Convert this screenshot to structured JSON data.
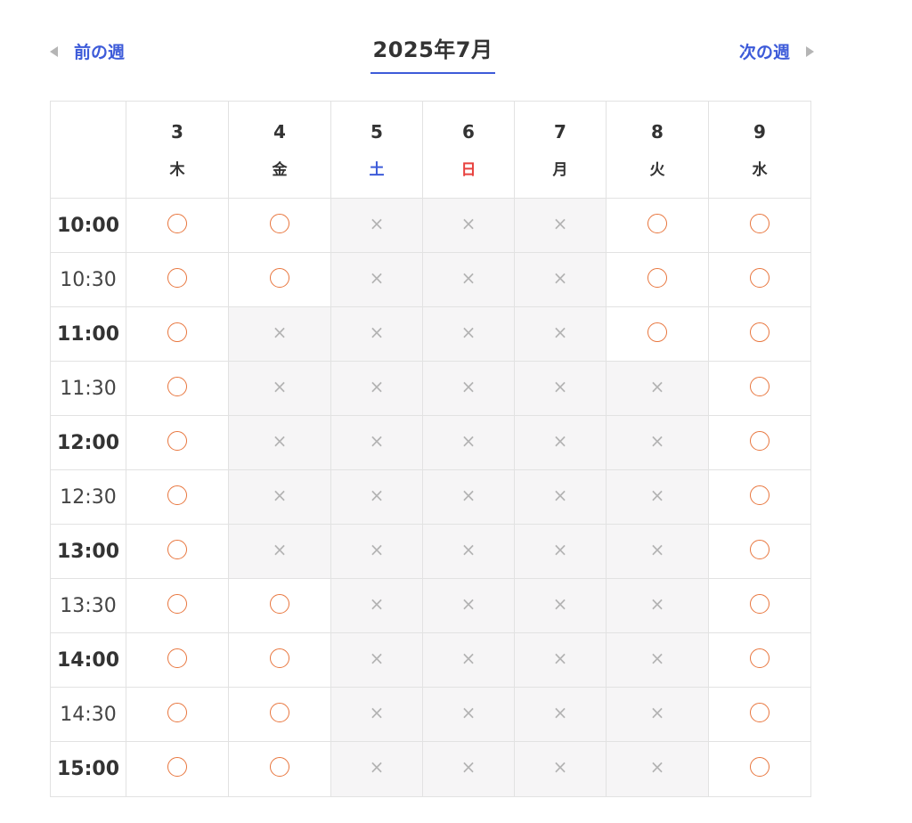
{
  "nav": {
    "prev_label": "前の週",
    "next_label": "次の週",
    "month_title": "2025年7月"
  },
  "colors": {
    "accent": "#3d5bd9",
    "sunday": "#e8423f",
    "available": "#e8763e",
    "unavailable": "#b3b3b3",
    "closed_bg": "#f6f5f6"
  },
  "symbols": {
    "available": "○",
    "unavailable": "×"
  },
  "days": [
    {
      "date": "3",
      "weekday": "木",
      "type": "weekday"
    },
    {
      "date": "4",
      "weekday": "金",
      "type": "weekday"
    },
    {
      "date": "5",
      "weekday": "土",
      "type": "saturday"
    },
    {
      "date": "6",
      "weekday": "日",
      "type": "sunday"
    },
    {
      "date": "7",
      "weekday": "月",
      "type": "weekday"
    },
    {
      "date": "8",
      "weekday": "火",
      "type": "weekday"
    },
    {
      "date": "9",
      "weekday": "水",
      "type": "weekday"
    }
  ],
  "times": [
    "10:00",
    "10:30",
    "11:00",
    "11:30",
    "12:00",
    "12:30",
    "13:00",
    "13:30",
    "14:00",
    "14:30",
    "15:00"
  ],
  "availability": [
    [
      1,
      1,
      0,
      0,
      0,
      1,
      1
    ],
    [
      1,
      1,
      0,
      0,
      0,
      1,
      1
    ],
    [
      1,
      0,
      0,
      0,
      0,
      1,
      1
    ],
    [
      1,
      0,
      0,
      0,
      0,
      0,
      1
    ],
    [
      1,
      0,
      0,
      0,
      0,
      0,
      1
    ],
    [
      1,
      0,
      0,
      0,
      0,
      0,
      1
    ],
    [
      1,
      0,
      0,
      0,
      0,
      0,
      1
    ],
    [
      1,
      1,
      0,
      0,
      0,
      0,
      1
    ],
    [
      1,
      1,
      0,
      0,
      0,
      0,
      1
    ],
    [
      1,
      1,
      0,
      0,
      0,
      0,
      1
    ],
    [
      1,
      1,
      0,
      0,
      0,
      0,
      1
    ]
  ]
}
